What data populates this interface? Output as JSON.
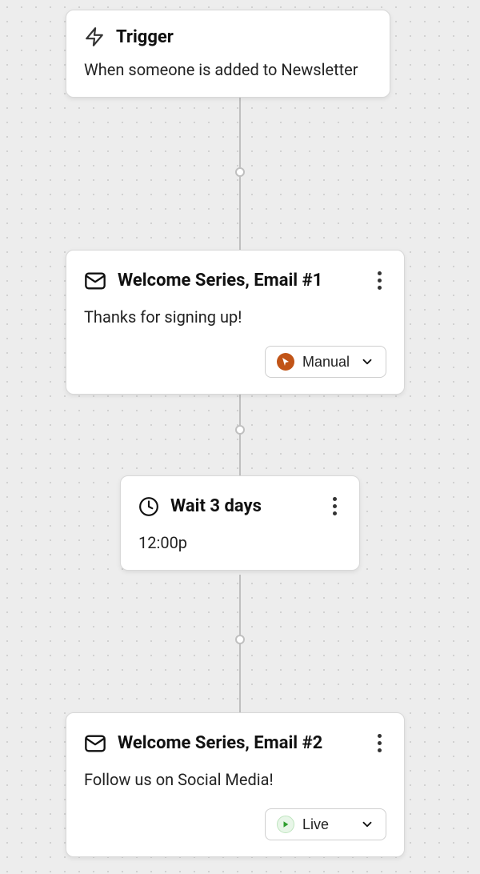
{
  "trigger": {
    "title": "Trigger",
    "description": "When someone is added to Newsletter"
  },
  "email1": {
    "title": "Welcome Series, Email #1",
    "subject": "Thanks for signing up!",
    "status": "Manual"
  },
  "wait": {
    "title": "Wait 3 days",
    "time": "12:00p"
  },
  "email2": {
    "title": "Welcome Series, Email #2",
    "subject": "Follow us on Social Media!",
    "status": "Live"
  }
}
